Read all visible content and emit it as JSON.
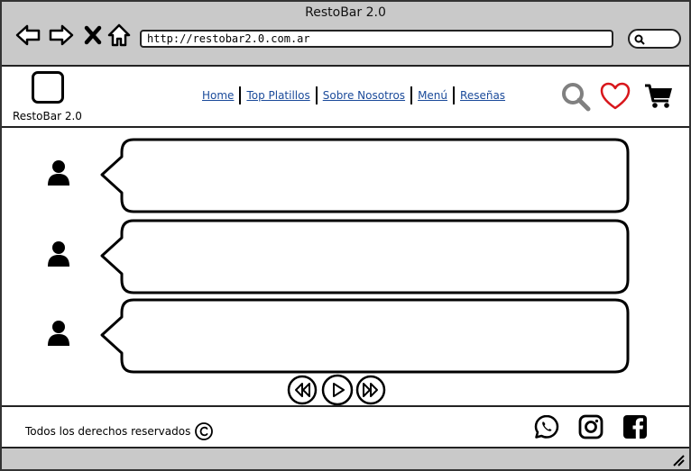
{
  "window": {
    "title": "RestoBar 2.0"
  },
  "browser": {
    "url": "http://restobar2.0.com.ar",
    "buttons": [
      "back-arrow-icon",
      "forward-arrow-icon",
      "close-icon",
      "home-icon"
    ]
  },
  "header": {
    "logo_text": "RestoBar 2.0",
    "nav": [
      "Home",
      "Top Platillos",
      "Sobre Nosotros",
      "Menú",
      "Reseñas"
    ],
    "icons": [
      "search-icon",
      "heart-icon",
      "cart-icon"
    ],
    "colors": {
      "heart": "#d8161b",
      "search": "#808080"
    }
  },
  "reviews": [
    {
      "icon": "user-icon",
      "text": ""
    },
    {
      "icon": "user-icon",
      "text": ""
    },
    {
      "icon": "user-icon",
      "text": ""
    }
  ],
  "carousel": {
    "buttons": [
      "rewind-icon",
      "play-icon",
      "fast-forward-icon"
    ]
  },
  "footer": {
    "copyright": "Todos los derechos reservados",
    "social": [
      "whatsapp-icon",
      "instagram-icon",
      "facebook-icon"
    ]
  }
}
